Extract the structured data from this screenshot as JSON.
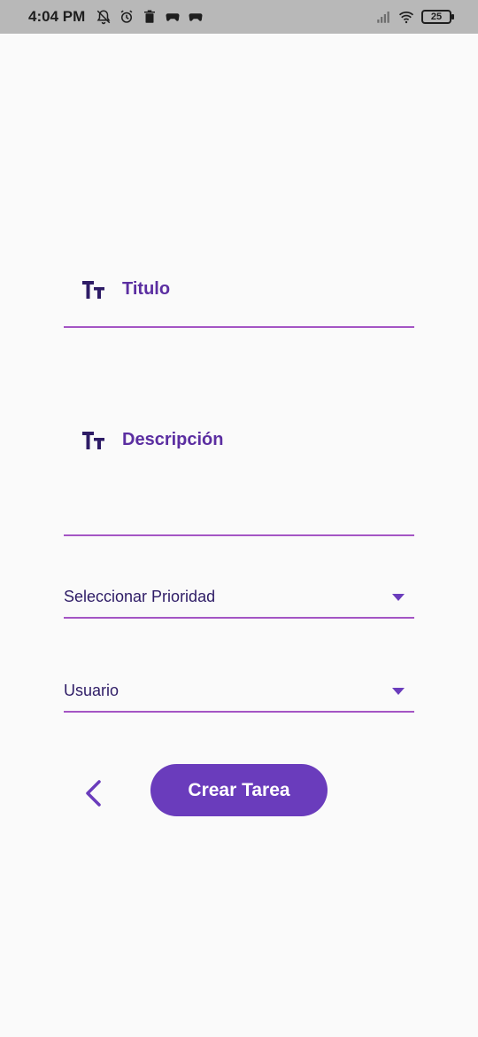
{
  "status_bar": {
    "time": "4:04 PM",
    "battery_level": "25",
    "icons_left": [
      "bell-off-icon",
      "alarm-icon",
      "trash-icon",
      "game-controller-icon",
      "game-controller-icon"
    ],
    "icons_right": [
      "signal-icon",
      "wifi-icon",
      "battery-icon"
    ]
  },
  "form": {
    "title_label": "Titulo",
    "description_label": "Descripción",
    "priority_placeholder": "Seleccionar Prioridad",
    "user_placeholder": "Usuario",
    "submit_label": "Crear Tarea"
  },
  "colors": {
    "accent": "#6a3cbc",
    "label": "#5b2ea1",
    "underline": "#a455c4",
    "background": "#fafafa",
    "status_bar": "#b8b8b8"
  }
}
